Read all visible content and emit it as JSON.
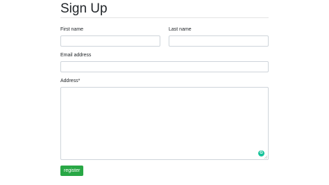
{
  "form": {
    "title": "Sign Up",
    "first_name_label": "First name",
    "first_name_value": "",
    "last_name_label": "Last name",
    "last_name_value": "",
    "email_label": "Email address",
    "email_value": "",
    "address_label": "Address*",
    "address_value": "",
    "grammarly_icon": "G",
    "submit_label": "register"
  },
  "colors": {
    "button_green": "#28a745",
    "grammarly_green": "#15c39a",
    "border": "#ced4da"
  }
}
